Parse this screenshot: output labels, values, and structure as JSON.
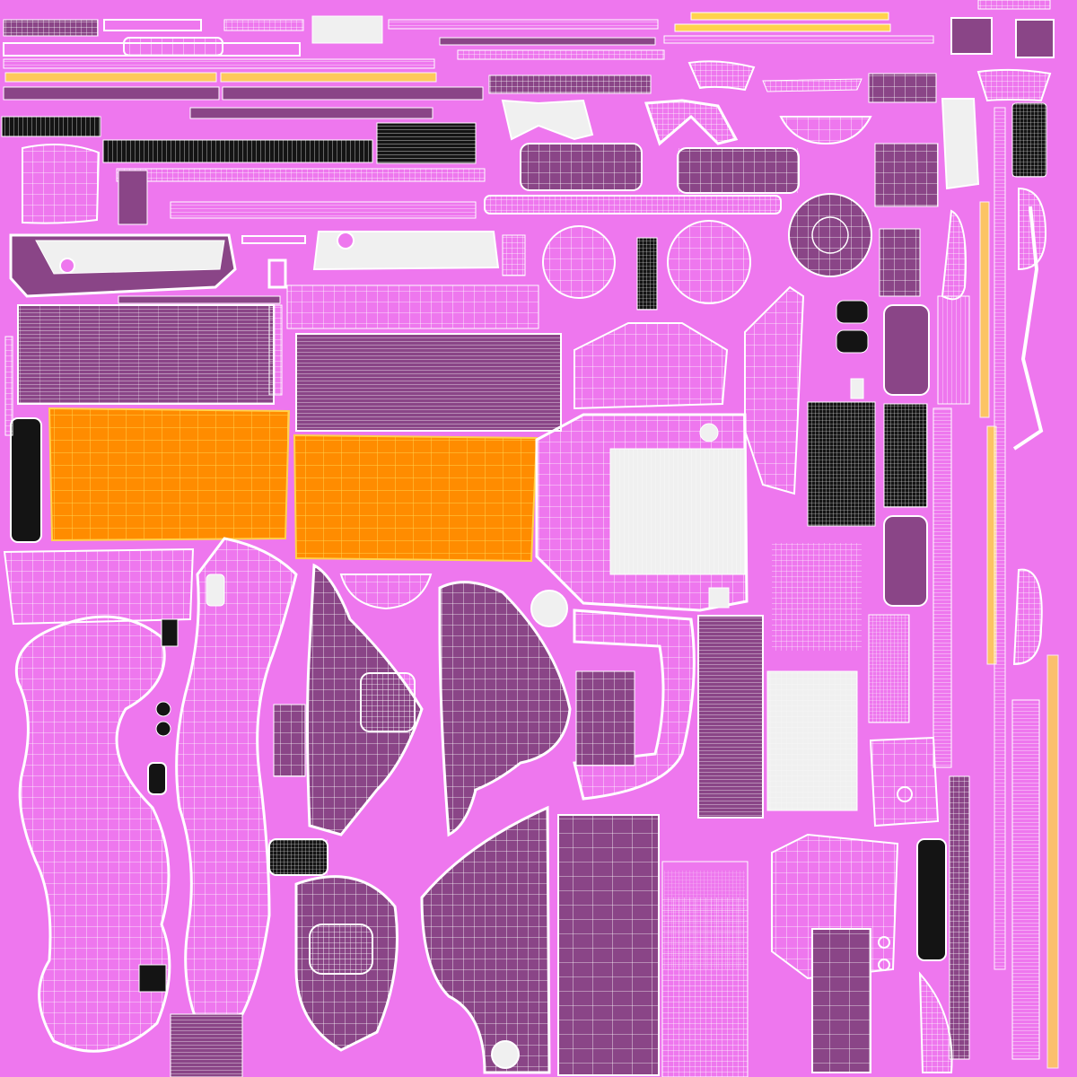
{
  "colors": {
    "background": "#ee77ee",
    "wire": "#ffffff",
    "dark_fill": "#8a4587",
    "orange_fill": "#ff8c00",
    "orange_wire": "#ffd24d",
    "light_fill": "#f0f0f0",
    "black_fill": "#141414"
  }
}
